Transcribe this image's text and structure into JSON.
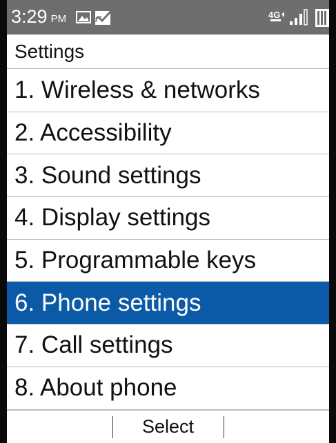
{
  "status_bar": {
    "time": "3:29",
    "ampm": "PM",
    "icons": [
      "image-notification-icon",
      "message-notification-icon",
      "4g-lte-icon",
      "signal-icon",
      "battery-icon"
    ],
    "network_label": "4G"
  },
  "header": {
    "title": "Settings"
  },
  "menu": {
    "items": [
      {
        "label": "1. Wireless & networks"
      },
      {
        "label": "2. Accessibility"
      },
      {
        "label": "3. Sound settings"
      },
      {
        "label": "4. Display settings"
      },
      {
        "label": "5. Programmable keys"
      },
      {
        "label": "6. Phone settings"
      },
      {
        "label": "7. Call settings"
      },
      {
        "label": "8. About phone"
      }
    ],
    "selected_index": 5
  },
  "softkeys": {
    "left": "",
    "center": "Select",
    "right": ""
  },
  "colors": {
    "selection": "#0b5aa8",
    "status_bar": "#6e6e6e"
  }
}
